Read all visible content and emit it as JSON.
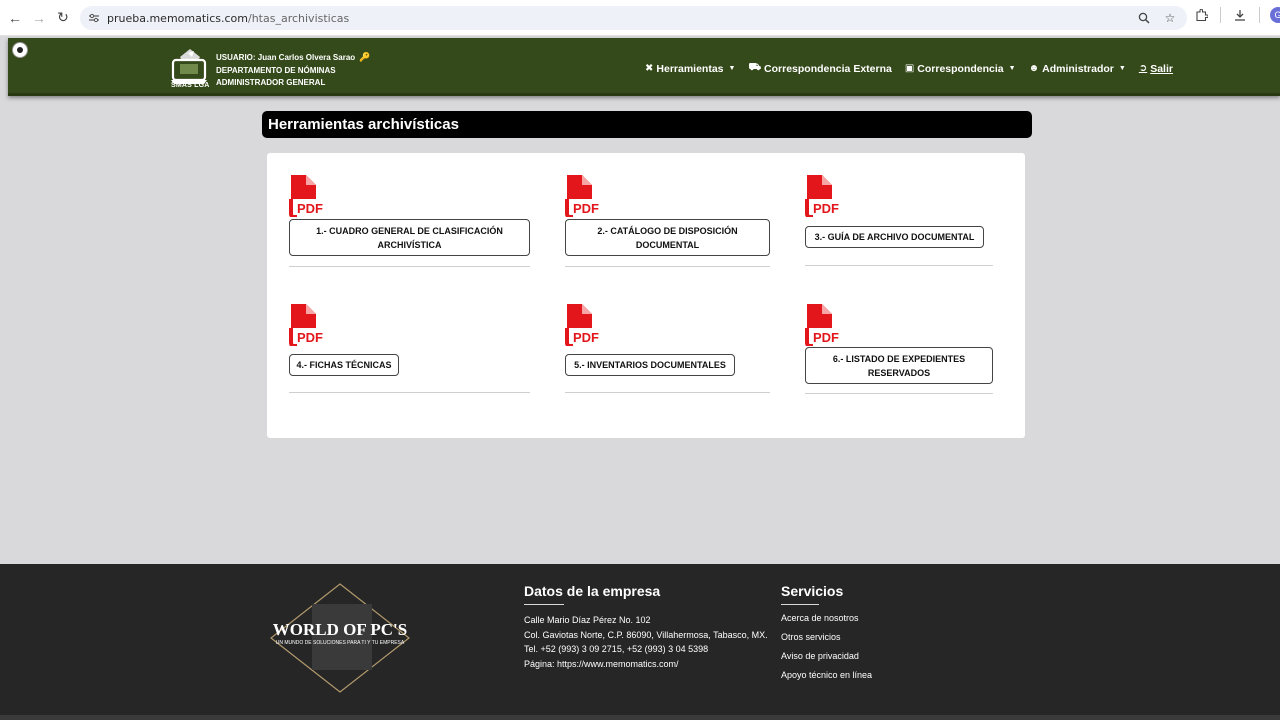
{
  "browser": {
    "url_host": "prueba.memomatics.com",
    "url_path": "/htas_archivisticas",
    "profile_initial": "G",
    "icons": [
      "back-icon",
      "forward-icon",
      "reload-icon",
      "site-info-icon",
      "zoom-icon",
      "star-icon",
      "extensions-icon",
      "download-icon"
    ]
  },
  "header": {
    "logo_text": "SMAS LGA",
    "user_line": "USUARIO: Juan Carlos Olvera Sarao",
    "department": "DEPARTAMENTO DE NÓMINAS",
    "role": "ADMINISTRADOR GENERAL",
    "nav": {
      "herramientas": "Herramientas",
      "correspondencia_externa": "Correspondencia Externa",
      "correspondencia": "Correspondencia",
      "administrador": "Administrador",
      "salir": "Salir"
    },
    "colors": {
      "bar": "#354a1b",
      "text": "#ffffff"
    }
  },
  "page": {
    "title": "Herramientas archivísticas"
  },
  "tools": {
    "pdf_label": "PDF",
    "items": [
      {
        "line1": "1.- CUADRO GENERAL DE CLASIFICACIÓN",
        "line2": "ARCHIVÍSTICA"
      },
      {
        "line1": "2.- CATÁLOGO DE DISPOSICIÓN",
        "line2": "DOCUMENTAL"
      },
      {
        "line1": "3.- GUÍA DE ARCHIVO DOCUMENTAL",
        "line2": ""
      },
      {
        "line1": "4.- FICHAS TÉCNICAS",
        "line2": ""
      },
      {
        "line1": "5.- INVENTARIOS DOCUMENTALES",
        "line2": ""
      },
      {
        "line1": "6.- LISTADO DE EXPEDIENTES",
        "line2": "RESERVADOS"
      }
    ],
    "colors": {
      "pdf_red": "#e3161b"
    }
  },
  "footer": {
    "logo_title": "WORLD OF PC'S",
    "logo_subtitle": "UN MUNDO DE SOLUCIONES PARA TI Y TU EMPRESA",
    "company_title": "Datos de la empresa",
    "company_lines": [
      "Calle Mario Díaz Pérez No. 102",
      "Col. Gaviotas Norte, C.P. 86090, Villahermosa, Tabasco, MX.",
      "Tel. +52 (993) 3 09 2715, +52 (993) 3 04 5398",
      "Página: https://www.memomatics.com/"
    ],
    "services_title": "Servicios",
    "services_links": [
      "Acerca de nosotros",
      "Otros servicios",
      "Aviso de privacidad",
      "Apoyo técnico en línea"
    ]
  }
}
